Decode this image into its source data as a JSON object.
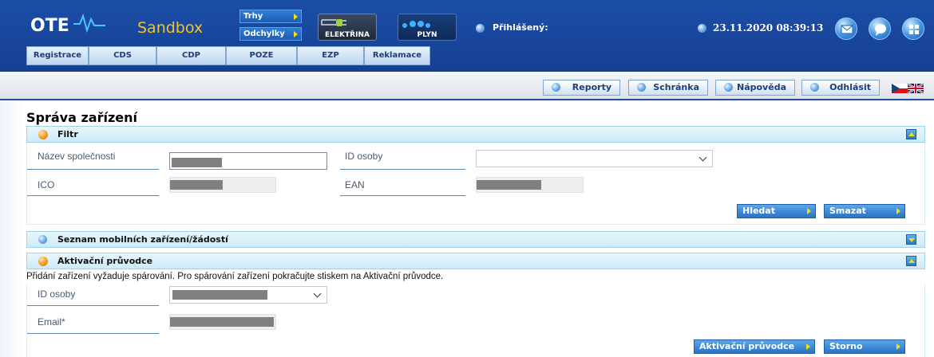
{
  "header": {
    "logo_text": "OTE",
    "env_label": "Sandbox",
    "trhy_label": "Trhy",
    "odchylky_label": "Odchylky",
    "commodity_electricity": "ELEKTŘINA",
    "commodity_gas": "PLYN",
    "logged_in_label": "Přihlášený:",
    "datetime": "23.11.2020 08:39:13",
    "accent_color": "#1b4ea8",
    "env_color": "#f5c518"
  },
  "nav": {
    "items": [
      "Registrace",
      "CDS",
      "CDP",
      "POZE",
      "EZP",
      "Reklamace"
    ]
  },
  "toolbar": {
    "reports": "Reporty",
    "inbox": "Schránka",
    "help": "Nápověda",
    "logout": "Odhlásit"
  },
  "page": {
    "title": "Správa zařízení"
  },
  "filter": {
    "title": "Filtr",
    "company_label": "Název společnosti",
    "person_id_label": "ID osoby",
    "ico_label": "ICO",
    "ean_label": "EAN",
    "search_button": "Hledat",
    "clear_button": "Smazat"
  },
  "devices": {
    "title": "Seznam mobilních zařízení/žádostí"
  },
  "wizard": {
    "title": "Aktivační průvodce",
    "info": "Přidání zařízení vyžaduje spárování. Pro spárování zařízení pokračujte stiskem na Aktivační průvodce.",
    "person_id_label": "ID osoby",
    "email_label": "Email*",
    "activate_button": "Aktivační průvodce",
    "cancel_button": "Storno"
  }
}
